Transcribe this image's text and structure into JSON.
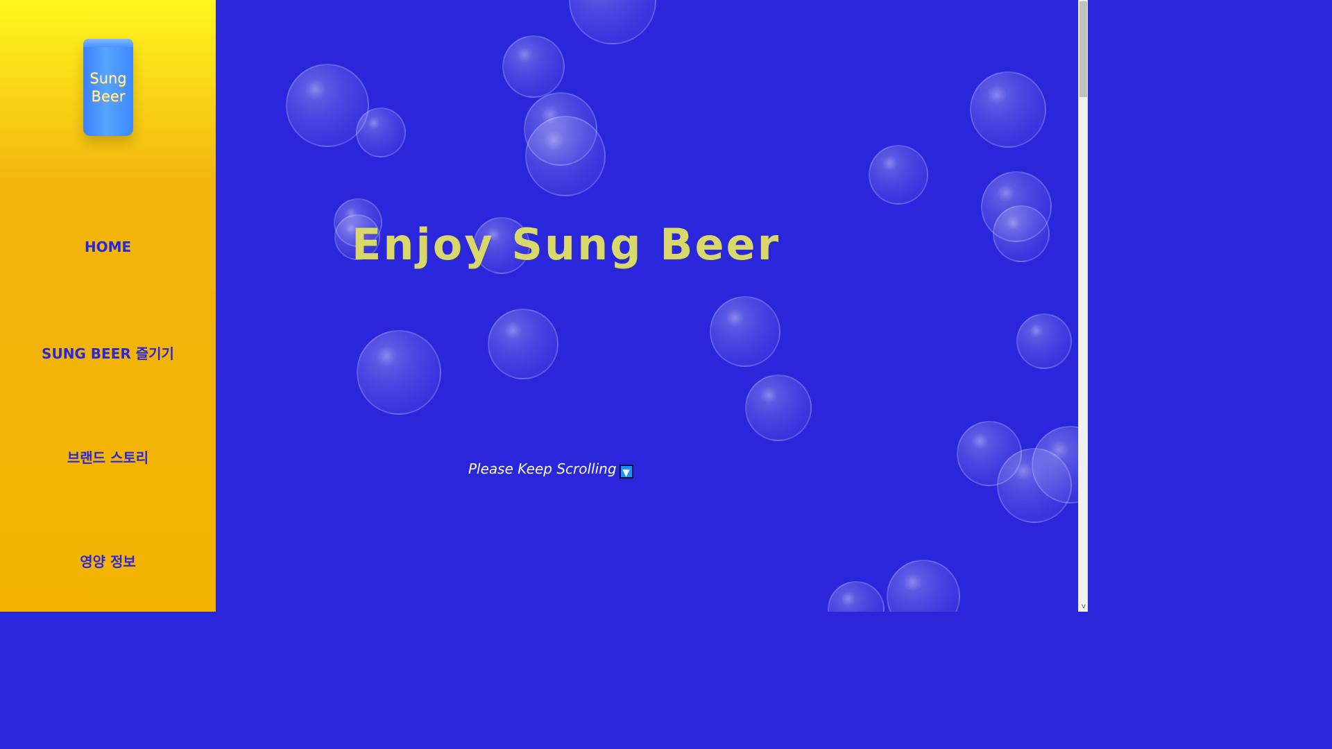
{
  "sidebar": {
    "logo": {
      "line1": "Sung",
      "line2": "Beer"
    },
    "items": [
      {
        "label": "HOME"
      },
      {
        "label": "SUNG BEER 즐기기"
      },
      {
        "label": "브랜드 스토리"
      },
      {
        "label": "영양 정보"
      }
    ],
    "toggle_icon": "chevron-left-icon"
  },
  "main": {
    "headline": "Enjoy Sung Beer",
    "hint_text": "Please Keep Scrolling",
    "hint_icon": "▼",
    "background_color": "#2a26dc",
    "headline_color": "#d8d86b"
  },
  "scrollbar": {
    "up_icon": "^",
    "down_icon": "v"
  }
}
